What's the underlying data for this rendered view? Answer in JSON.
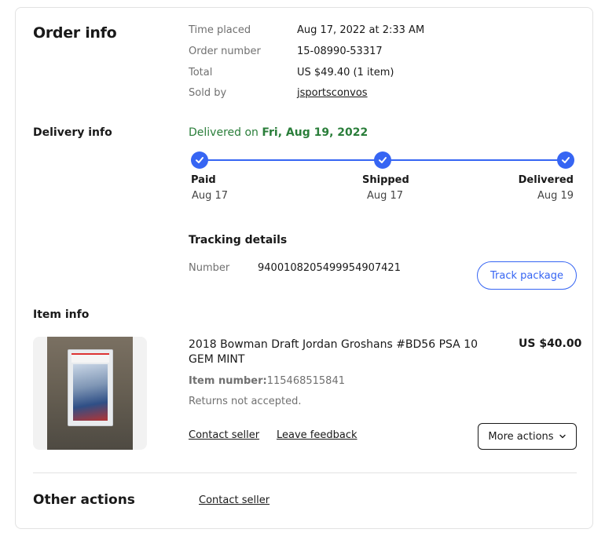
{
  "order_info": {
    "heading": "Order info",
    "rows": [
      {
        "label": "Time placed",
        "value": "Aug 17, 2022 at 2:33 AM"
      },
      {
        "label": "Order number",
        "value": "15-08990-53317"
      },
      {
        "label": "Total",
        "value": "US $49.40 (1 item)"
      },
      {
        "label": "Sold by",
        "value": "jsportsconvos"
      }
    ]
  },
  "delivery_info": {
    "heading": "Delivery info",
    "status_prefix": "Delivered on ",
    "status_date": "Fri, Aug 19, 2022",
    "steps": [
      {
        "label": "Paid",
        "date": "Aug 17"
      },
      {
        "label": "Shipped",
        "date": "Aug 17"
      },
      {
        "label": "Delivered",
        "date": "Aug 19"
      }
    ],
    "tracking_heading": "Tracking details",
    "tracking_number_label": "Number",
    "tracking_number": "9400108205499954907421",
    "track_button": "Track package"
  },
  "item_info": {
    "heading": "Item info",
    "title": "2018 Bowman Draft Jordan Groshans #BD56 PSA 10 GEM MINT",
    "price": "US $40.00",
    "item_number_label": "Item number:",
    "item_number": "115468515841",
    "returns": "Returns not accepted.",
    "contact_seller": "Contact seller",
    "leave_feedback": "Leave feedback",
    "more_actions": "More actions"
  },
  "other_actions": {
    "heading": "Other actions",
    "contact_seller": "Contact seller"
  },
  "colors": {
    "accent": "#3665f3",
    "delivered_green": "#2a7e3a"
  },
  "icons": [
    "check-icon",
    "chevron-down-icon"
  ]
}
